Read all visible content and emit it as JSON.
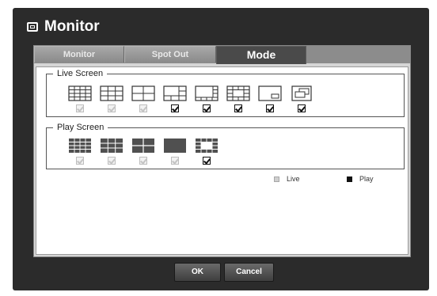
{
  "window": {
    "title": "Monitor",
    "title_icon": "monitor-icon"
  },
  "tabs": [
    {
      "label": "Monitor",
      "active": false
    },
    {
      "label": "Spot Out",
      "active": false
    },
    {
      "label": "Mode",
      "active": true
    }
  ],
  "live_screen": {
    "label": "Live Screen",
    "layouts": [
      {
        "icon": "split-16-icon",
        "checked": true,
        "editable": false
      },
      {
        "icon": "split-9-icon",
        "checked": true,
        "editable": false
      },
      {
        "icon": "split-4-icon",
        "checked": true,
        "editable": false
      },
      {
        "icon": "split-6-icon",
        "checked": true,
        "editable": true
      },
      {
        "icon": "split-8-icon",
        "checked": true,
        "editable": true
      },
      {
        "icon": "split-13-icon",
        "checked": true,
        "editable": true
      },
      {
        "icon": "pip-icon",
        "checked": true,
        "editable": true
      },
      {
        "icon": "sequence-icon",
        "checked": true,
        "editable": true
      }
    ]
  },
  "play_screen": {
    "label": "Play Screen",
    "layouts": [
      {
        "icon": "play-split-16-icon",
        "checked": true,
        "editable": false
      },
      {
        "icon": "play-split-9-icon",
        "checked": true,
        "editable": false
      },
      {
        "icon": "play-split-4-icon",
        "checked": true,
        "editable": false
      },
      {
        "icon": "play-single-icon",
        "checked": true,
        "editable": false
      },
      {
        "icon": "play-split-13-icon",
        "checked": true,
        "editable": true
      }
    ]
  },
  "legend": {
    "live_label": "Live",
    "play_label": "Play"
  },
  "buttons": {
    "ok_label": "OK",
    "cancel_label": "Cancel"
  }
}
